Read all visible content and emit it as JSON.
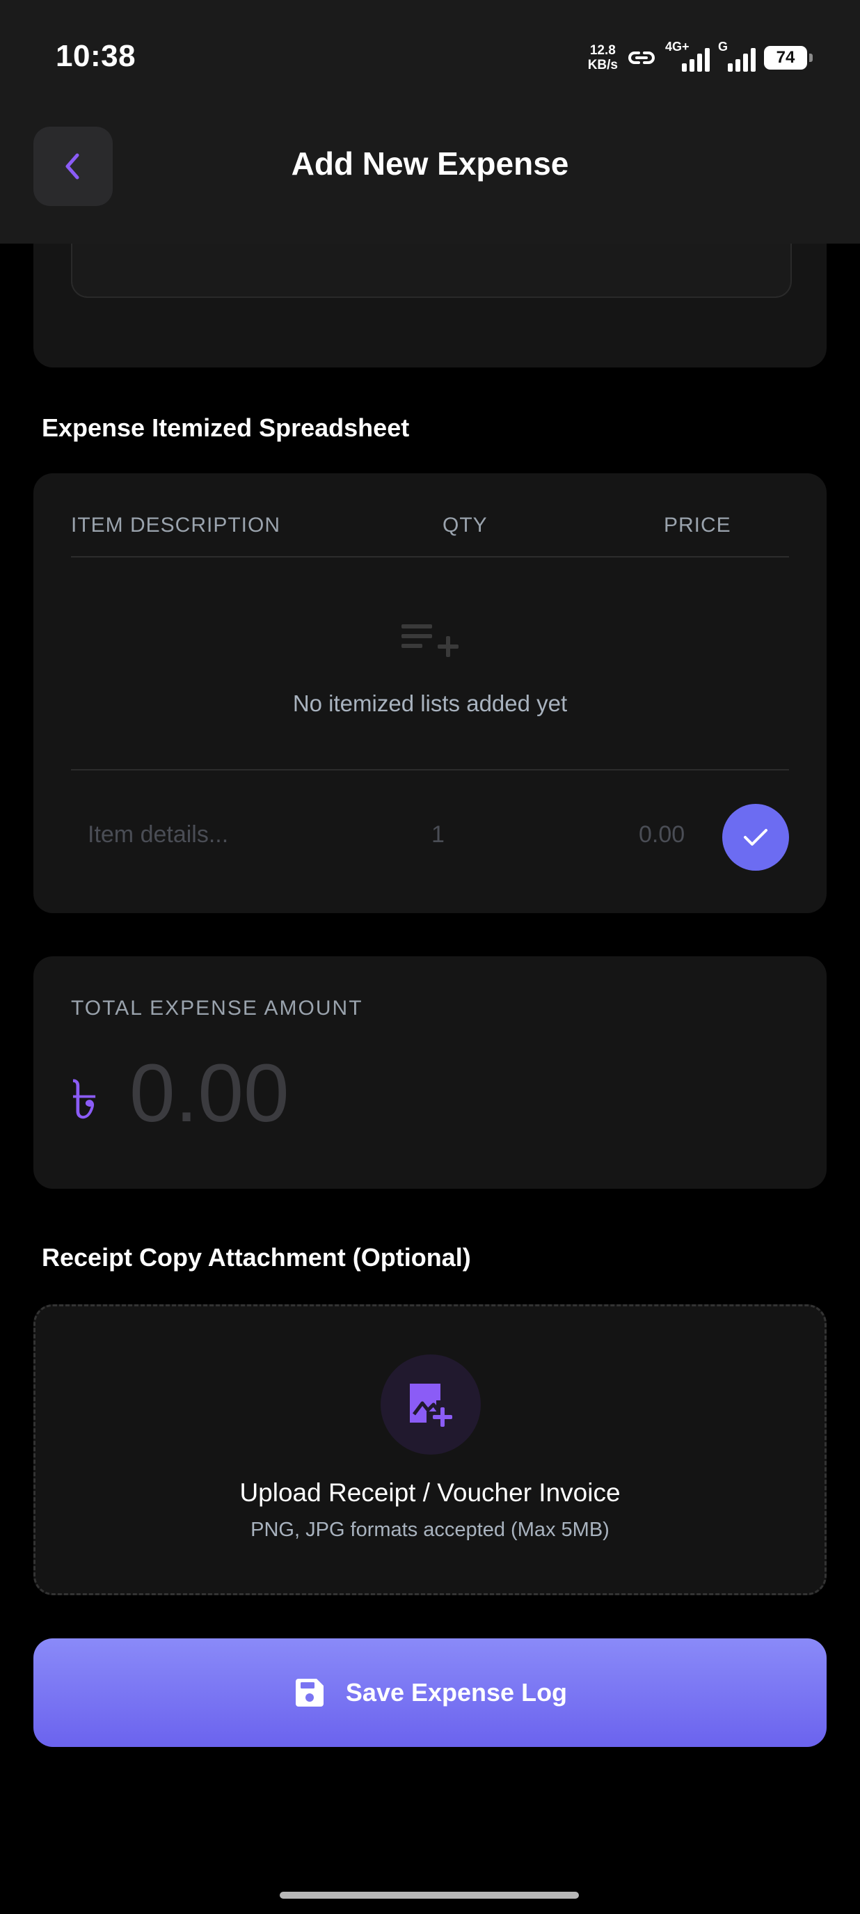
{
  "status_bar": {
    "time": "10:38",
    "net_speed_value": "12.8",
    "net_speed_unit": "KB/s",
    "signal1_tag": "4G+",
    "signal2_tag": "G",
    "battery": "74"
  },
  "header": {
    "title": "Add New Expense",
    "back_icon": "chevron-left-icon"
  },
  "itemized": {
    "section_title": "Expense Itemized Spreadsheet",
    "columns": [
      "ITEM DESCRIPTION",
      "QTY",
      "PRICE"
    ],
    "empty_icon": "playlist-add-icon",
    "empty_text": "No itemized lists added yet",
    "new_row": {
      "description_placeholder": "Item details...",
      "qty_value": "1",
      "price_placeholder": "0.00"
    },
    "confirm_icon": "check-icon"
  },
  "total": {
    "label": "TOTAL EXPENSE AMOUNT",
    "currency_symbol": "৳",
    "value": "0.00"
  },
  "receipt": {
    "section_title": "Receipt Copy Attachment (Optional)",
    "icon": "add-photo-icon",
    "upload_title": "Upload Receipt / Voucher Invoice",
    "upload_subtitle": "PNG, JPG formats accepted (Max 5MB)"
  },
  "save_button": {
    "label": "Save Expense Log",
    "icon": "save-icon"
  },
  "colors": {
    "accent": "#8b5cf6",
    "button": "#6c6cf2",
    "background": "#000000",
    "card": "#151515"
  }
}
